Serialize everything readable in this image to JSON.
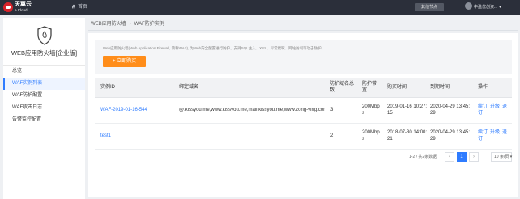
{
  "topbar": {
    "brand_cn": "天翼云",
    "brand_en": "e Cloud",
    "home_label": "首页",
    "node_button": "其他节点",
    "user_name": "中盈优创资..."
  },
  "sidebar": {
    "product_title": "WEB应用防火墙[企业版]",
    "items": [
      {
        "label": "总览"
      },
      {
        "label": "WAF实例列表"
      },
      {
        "label": "WAF防护配置"
      },
      {
        "label": "WAF攻击日志"
      },
      {
        "label": "告警监控配置"
      }
    ]
  },
  "breadcrumb": {
    "parent": "WEB应用防火墙",
    "current": "WAF防护实例"
  },
  "notice": {
    "text": "Web应用防火墙(Web Application Firewall, 简称WAF), 为Web安全配置进行防护，支持SQL注入、XSS、异常爬取、网站访问等攻击防护。",
    "buy_button": "+ 立即购买"
  },
  "table": {
    "headers": {
      "id": "实例ID",
      "domain": "绑定域名",
      "count": "防护域名总数",
      "bandwidth": "防护带宽",
      "buy_time": "购买时间",
      "expire_time": "到期时间",
      "actions": "操作"
    },
    "rows": [
      {
        "id": "WAF-2019-01-16-544",
        "domain": "@.kissyou.me,www.kissyou.me,mail.kissyou.me,www.zong-ying.com",
        "count": "3",
        "bandwidth": "200Mbps",
        "buy_time": "2019-01-16 10:27:15",
        "expire_time": "2020-04-29 13:45:29",
        "actions": [
          "续订",
          "升级",
          "退订"
        ]
      },
      {
        "id": "test1",
        "domain": "",
        "count": "2",
        "bandwidth": "200Mbps",
        "buy_time": "2018-07-30 14:00:21",
        "expire_time": "2020-04-29 13:45:29",
        "actions": [
          "续订",
          "升级",
          "退订"
        ]
      }
    ]
  },
  "pagination": {
    "total": "1-2 / 共2条数据",
    "prev": "‹",
    "current": "1",
    "next": "›",
    "page_size": "10 条/页"
  },
  "colors": {
    "accent": "#2f7cff",
    "buy_button": "#ff8d1a",
    "topbar": "#2b2f3a"
  }
}
